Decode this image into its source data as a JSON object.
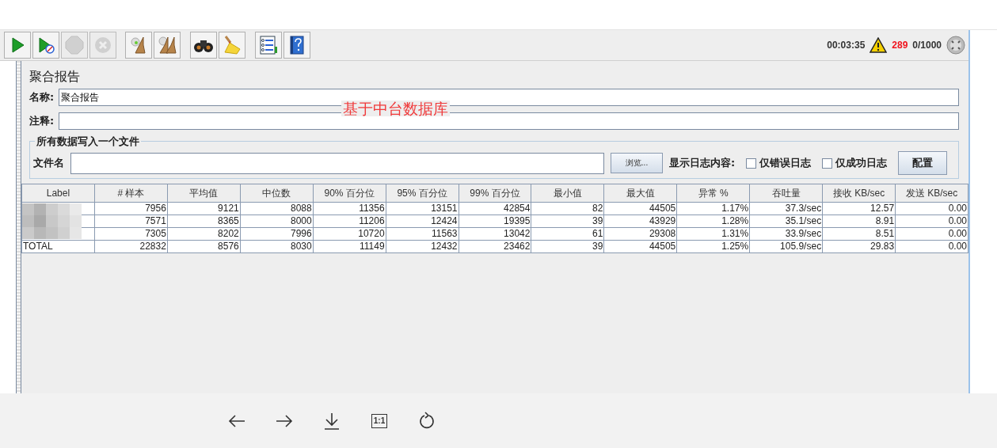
{
  "toolbar": {
    "buttons": [
      {
        "kind": "start",
        "disabled": false
      },
      {
        "kind": "start-nopause",
        "disabled": false
      },
      {
        "kind": "stop",
        "disabled": true
      },
      {
        "kind": "shutdown",
        "disabled": true
      },
      {
        "kind": "clear",
        "disabled": false
      },
      {
        "kind": "clear-all",
        "disabled": false
      },
      {
        "kind": "search",
        "disabled": false
      },
      {
        "kind": "reset",
        "disabled": false
      },
      {
        "kind": "function",
        "disabled": false
      },
      {
        "kind": "help",
        "disabled": false
      }
    ],
    "elapsed": "00:03:35",
    "warnings": "289",
    "threads": "0/1000"
  },
  "panel": {
    "title": "聚合报告",
    "name_label": "名称:",
    "name_value": "聚合报告",
    "comment_label": "注释:",
    "annotation": "基于中台数据库",
    "file_group": {
      "legend": "所有数据写入一个文件",
      "file_label": "文件名",
      "browse": "浏览...",
      "log_label": "显示日志内容:",
      "checkboxes": [
        {
          "label": "仅错误日志",
          "checked": false
        },
        {
          "label": "仅成功日志",
          "checked": false
        }
      ],
      "config": "配置"
    }
  },
  "table": {
    "columns": [
      "Label",
      "# 样本",
      "平均值",
      "中位数",
      "90% 百分位",
      "95% 百分位",
      "99% 百分位",
      "最小值",
      "最大值",
      "异常 %",
      "吞吐量",
      "接收 KB/sec",
      "发送 KB/sec"
    ],
    "rows": [
      [
        "",
        "7956",
        "9121",
        "8088",
        "11356",
        "13151",
        "42854",
        "82",
        "44505",
        "1.17%",
        "37.3/sec",
        "12.57",
        "0.00"
      ],
      [
        "",
        "7571",
        "8365",
        "8000",
        "11206",
        "12424",
        "19395",
        "39",
        "43929",
        "1.28%",
        "35.1/sec",
        "8.91",
        "0.00"
      ],
      [
        "",
        "7305",
        "8202",
        "7996",
        "10720",
        "11563",
        "13042",
        "61",
        "29308",
        "1.31%",
        "33.9/sec",
        "8.51",
        "0.00"
      ],
      [
        "TOTAL",
        "22832",
        "8576",
        "8030",
        "11149",
        "12432",
        "23462",
        "39",
        "44505",
        "1.25%",
        "105.9/sec",
        "29.83",
        "0.00"
      ]
    ],
    "redacted": true
  },
  "viewer_bar": {
    "buttons": [
      {
        "kind": "back"
      },
      {
        "kind": "forward"
      },
      {
        "kind": "download"
      },
      {
        "kind": "actual-size",
        "label": "1:1"
      },
      {
        "kind": "rotate"
      }
    ]
  }
}
